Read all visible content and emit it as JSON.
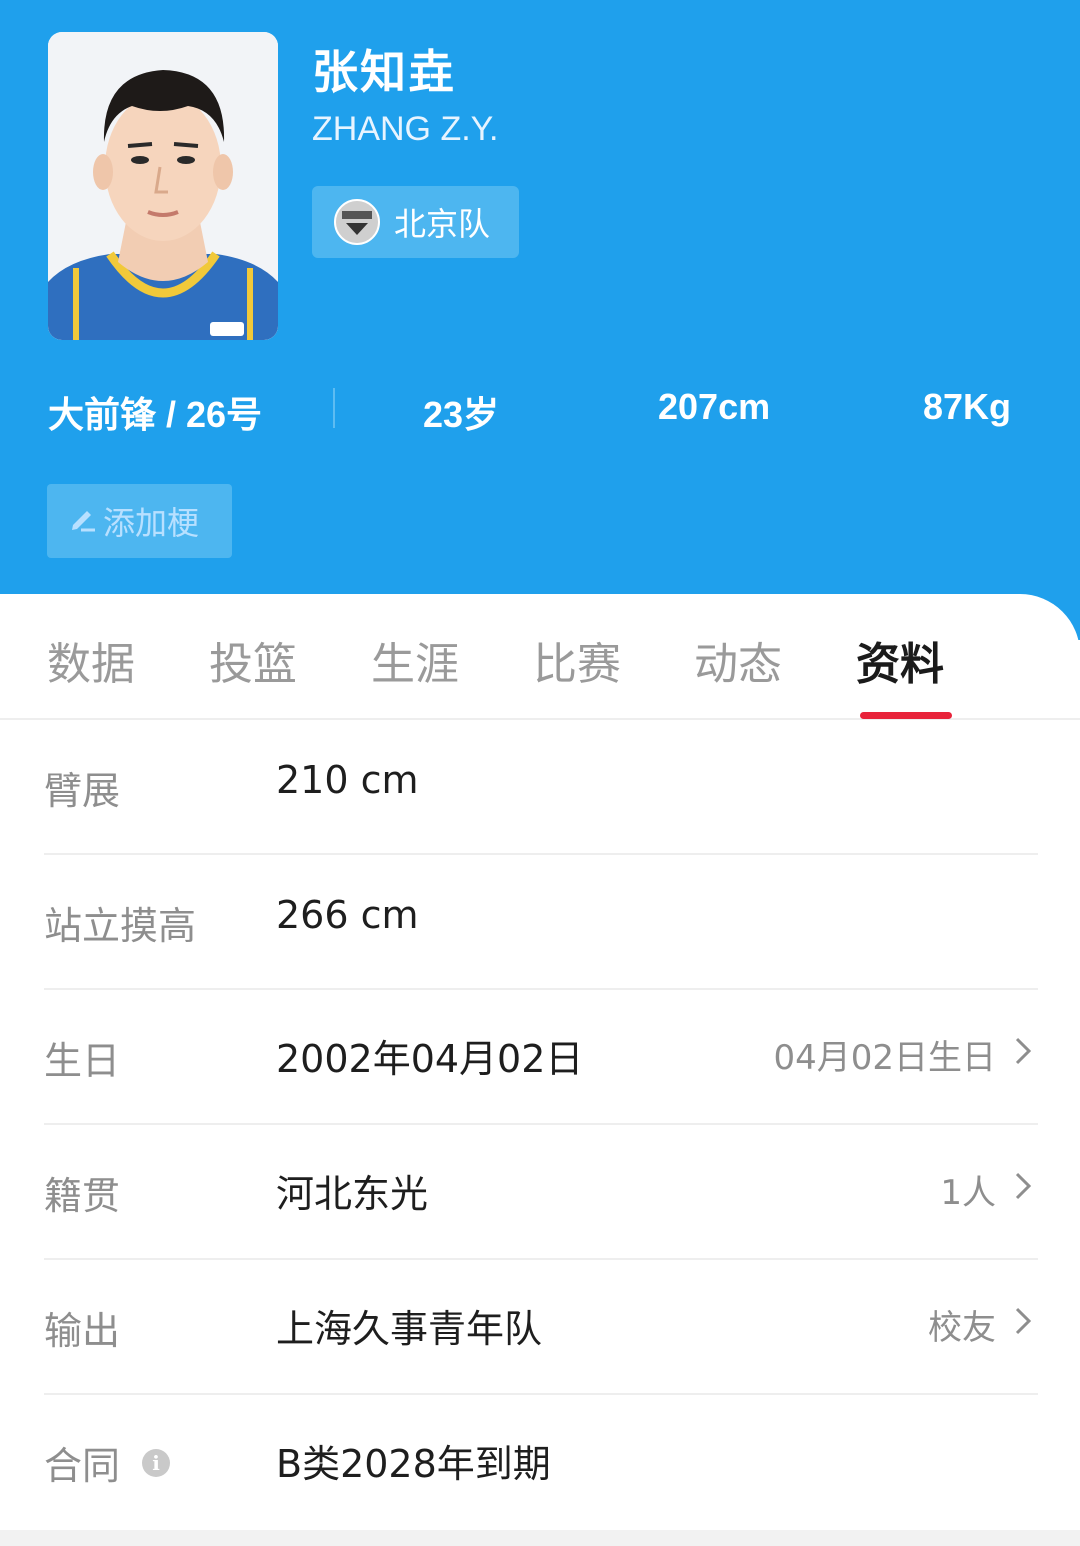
{
  "player": {
    "name": "张知垚",
    "name_en": "ZHANG Z.Y.",
    "team": "北京队"
  },
  "stats": {
    "position_number": "大前锋 / 26号",
    "age": "23岁",
    "height": "207cm",
    "weight": "87Kg"
  },
  "add_tag_label": "添加梗",
  "tabs": [
    {
      "label": "数据",
      "active": false
    },
    {
      "label": "投篮",
      "active": false
    },
    {
      "label": "生涯",
      "active": false
    },
    {
      "label": "比赛",
      "active": false
    },
    {
      "label": "动态",
      "active": false
    },
    {
      "label": "资料",
      "active": true
    }
  ],
  "profile": [
    {
      "label": "臂展",
      "value": "210 cm",
      "extra": ""
    },
    {
      "label": "站立摸高",
      "value": "266 cm",
      "extra": ""
    },
    {
      "label": "生日",
      "value": "2002年04月02日",
      "extra": "04月02日生日"
    },
    {
      "label": "籍贯",
      "value": "河北东光",
      "extra": "1人"
    },
    {
      "label": "输出",
      "value": "上海久事青年队",
      "extra": "校友"
    },
    {
      "label": "合同",
      "value": "B类2028年到期",
      "extra": ""
    }
  ],
  "colors": {
    "header_bg": "#1fa0ec",
    "active_tab_underline": "#e8233a"
  }
}
